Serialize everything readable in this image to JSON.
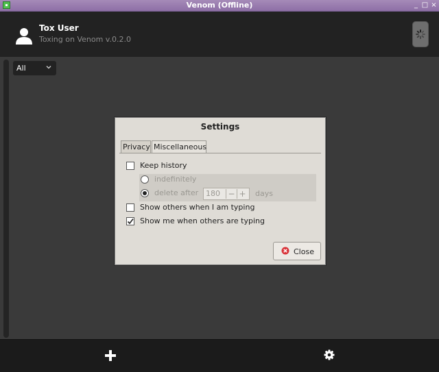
{
  "window": {
    "title": "Venom (Offline)",
    "controls": [
      "_",
      "□",
      "×"
    ]
  },
  "header": {
    "username": "Tox User",
    "status": "Toxing on Venom v.0.2.0"
  },
  "filter": {
    "value": "All"
  },
  "dialog": {
    "title": "Settings",
    "tabs": [
      {
        "label": "Privacy"
      },
      {
        "label": "Miscellaneous"
      }
    ],
    "keep_history": {
      "label": "Keep history",
      "checked": false
    },
    "indefinitely": {
      "label": "indefinitely",
      "checked": false
    },
    "delete_after": {
      "label": "delete after",
      "checked": true,
      "value": "180",
      "unit": "days",
      "minus": "−",
      "plus": "+"
    },
    "typing_out": {
      "label": "Show others when I am typing",
      "checked": false
    },
    "typing_in": {
      "label": "Show me when others are typing",
      "checked": true
    },
    "close_label": "Close"
  },
  "icons": {
    "avatar": "user-icon",
    "status": "spinner-icon",
    "add": "add-icon",
    "settings": "gear-icon",
    "close": "close-circle-icon"
  },
  "colors": {
    "titlebar": "#9a7db0",
    "dialog": "#dfdcd6",
    "close_icon": "#d9343a"
  }
}
